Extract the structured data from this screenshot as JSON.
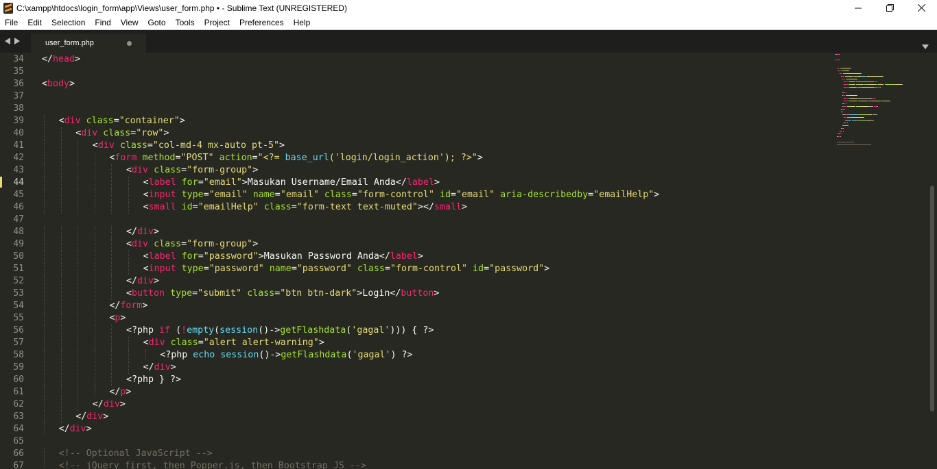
{
  "window": {
    "title": "C:\\xampp\\htdocs\\login_form\\app\\Views\\user_form.php • - Sublime Text (UNREGISTERED)"
  },
  "menu": [
    "File",
    "Edit",
    "Selection",
    "Find",
    "View",
    "Goto",
    "Tools",
    "Project",
    "Preferences",
    "Help"
  ],
  "tab": {
    "label": "user_form.php"
  },
  "editor": {
    "current_line": 44,
    "lines": [
      {
        "n": "34",
        "indent": 0,
        "tokens": [
          [
            "p",
            "</"
          ],
          [
            "t",
            "head"
          ],
          [
            "p",
            ">"
          ]
        ]
      },
      {
        "n": "35",
        "indent": 0,
        "tokens": []
      },
      {
        "n": "36",
        "indent": 0,
        "tokens": [
          [
            "p",
            "<"
          ],
          [
            "t",
            "body"
          ],
          [
            "p",
            ">"
          ]
        ]
      },
      {
        "n": "37",
        "indent": 0,
        "tokens": []
      },
      {
        "n": "38",
        "indent": 0,
        "tokens": []
      },
      {
        "n": "39",
        "indent": 1,
        "tokens": [
          [
            "p",
            "<"
          ],
          [
            "t",
            "div"
          ],
          [
            "p",
            " "
          ],
          [
            "a",
            "class"
          ],
          [
            "p",
            "="
          ],
          [
            "s",
            "\"container\""
          ],
          [
            "p",
            ">"
          ]
        ]
      },
      {
        "n": "40",
        "indent": 2,
        "tokens": [
          [
            "p",
            "<"
          ],
          [
            "t",
            "div"
          ],
          [
            "p",
            " "
          ],
          [
            "a",
            "class"
          ],
          [
            "p",
            "="
          ],
          [
            "s",
            "\"row\""
          ],
          [
            "p",
            ">"
          ]
        ]
      },
      {
        "n": "41",
        "indent": 3,
        "tokens": [
          [
            "p",
            "<"
          ],
          [
            "t",
            "div"
          ],
          [
            "p",
            " "
          ],
          [
            "a",
            "class"
          ],
          [
            "p",
            "="
          ],
          [
            "s",
            "\"col-md-4 mx-auto pt-5\""
          ],
          [
            "p",
            ">"
          ]
        ]
      },
      {
        "n": "42",
        "indent": 4,
        "tokens": [
          [
            "p",
            "<"
          ],
          [
            "t",
            "form"
          ],
          [
            "p",
            " "
          ],
          [
            "a",
            "method"
          ],
          [
            "p",
            "="
          ],
          [
            "s",
            "\"POST\""
          ],
          [
            "p",
            " "
          ],
          [
            "a",
            "action"
          ],
          [
            "p",
            "="
          ],
          [
            "s",
            "\"<?= "
          ],
          [
            "f",
            "base_url"
          ],
          [
            "s",
            "('login/login_action'); ?>\""
          ],
          [
            "p",
            ">"
          ]
        ]
      },
      {
        "n": "43",
        "indent": 5,
        "tokens": [
          [
            "p",
            "<"
          ],
          [
            "t",
            "div"
          ],
          [
            "p",
            " "
          ],
          [
            "a",
            "class"
          ],
          [
            "p",
            "="
          ],
          [
            "s",
            "\"form-group\""
          ],
          [
            "p",
            ">"
          ]
        ]
      },
      {
        "n": "44",
        "indent": 6,
        "tokens": [
          [
            "p",
            "<"
          ],
          [
            "t",
            "label"
          ],
          [
            "p",
            " "
          ],
          [
            "a",
            "for"
          ],
          [
            "p",
            "="
          ],
          [
            "s",
            "\"email\""
          ],
          [
            "p",
            ">Masukan Username/Email Anda</"
          ],
          [
            "t",
            "label"
          ],
          [
            "p",
            ">"
          ]
        ]
      },
      {
        "n": "45",
        "indent": 6,
        "tokens": [
          [
            "p",
            "<"
          ],
          [
            "t",
            "input"
          ],
          [
            "p",
            " "
          ],
          [
            "a",
            "type"
          ],
          [
            "p",
            "="
          ],
          [
            "s",
            "\"email\""
          ],
          [
            "p",
            " "
          ],
          [
            "a",
            "name"
          ],
          [
            "p",
            "="
          ],
          [
            "s",
            "\"email\""
          ],
          [
            "p",
            " "
          ],
          [
            "a",
            "class"
          ],
          [
            "p",
            "="
          ],
          [
            "s",
            "\"form-control\""
          ],
          [
            "p",
            " "
          ],
          [
            "a",
            "id"
          ],
          [
            "p",
            "="
          ],
          [
            "s",
            "\"email\""
          ],
          [
            "p",
            " "
          ],
          [
            "a",
            "aria-describedby"
          ],
          [
            "p",
            "="
          ],
          [
            "s",
            "\"emailHelp\""
          ],
          [
            "p",
            ">"
          ]
        ]
      },
      {
        "n": "46",
        "indent": 6,
        "tokens": [
          [
            "p",
            "<"
          ],
          [
            "t",
            "small"
          ],
          [
            "p",
            " "
          ],
          [
            "a",
            "id"
          ],
          [
            "p",
            "="
          ],
          [
            "s",
            "\"emailHelp\""
          ],
          [
            "p",
            " "
          ],
          [
            "a",
            "class"
          ],
          [
            "p",
            "="
          ],
          [
            "s",
            "\"form-text text-muted\""
          ],
          [
            "p",
            "></"
          ],
          [
            "t",
            "small"
          ],
          [
            "p",
            ">"
          ]
        ]
      },
      {
        "n": "47",
        "indent": 0,
        "tokens": []
      },
      {
        "n": "48",
        "indent": 5,
        "tokens": [
          [
            "p",
            "</"
          ],
          [
            "t",
            "div"
          ],
          [
            "p",
            ">"
          ]
        ]
      },
      {
        "n": "49",
        "indent": 5,
        "tokens": [
          [
            "p",
            "<"
          ],
          [
            "t",
            "div"
          ],
          [
            "p",
            " "
          ],
          [
            "a",
            "class"
          ],
          [
            "p",
            "="
          ],
          [
            "s",
            "\"form-group\""
          ],
          [
            "p",
            ">"
          ]
        ]
      },
      {
        "n": "50",
        "indent": 6,
        "tokens": [
          [
            "p",
            "<"
          ],
          [
            "t",
            "label"
          ],
          [
            "p",
            " "
          ],
          [
            "a",
            "for"
          ],
          [
            "p",
            "="
          ],
          [
            "s",
            "\"password\""
          ],
          [
            "p",
            ">Masukan Password Anda</"
          ],
          [
            "t",
            "label"
          ],
          [
            "p",
            ">"
          ]
        ]
      },
      {
        "n": "51",
        "indent": 6,
        "tokens": [
          [
            "p",
            "<"
          ],
          [
            "t",
            "input"
          ],
          [
            "p",
            " "
          ],
          [
            "a",
            "type"
          ],
          [
            "p",
            "="
          ],
          [
            "s",
            "\"password\""
          ],
          [
            "p",
            " "
          ],
          [
            "a",
            "name"
          ],
          [
            "p",
            "="
          ],
          [
            "s",
            "\"password\""
          ],
          [
            "p",
            " "
          ],
          [
            "a",
            "class"
          ],
          [
            "p",
            "="
          ],
          [
            "s",
            "\"form-control\""
          ],
          [
            "p",
            " "
          ],
          [
            "a",
            "id"
          ],
          [
            "p",
            "="
          ],
          [
            "s",
            "\"password\""
          ],
          [
            "p",
            ">"
          ]
        ]
      },
      {
        "n": "52",
        "indent": 5,
        "tokens": [
          [
            "p",
            "</"
          ],
          [
            "t",
            "div"
          ],
          [
            "p",
            ">"
          ]
        ]
      },
      {
        "n": "53",
        "indent": 5,
        "tokens": [
          [
            "p",
            "<"
          ],
          [
            "t",
            "button"
          ],
          [
            "p",
            " "
          ],
          [
            "a",
            "type"
          ],
          [
            "p",
            "="
          ],
          [
            "s",
            "\"submit\""
          ],
          [
            "p",
            " "
          ],
          [
            "a",
            "class"
          ],
          [
            "p",
            "="
          ],
          [
            "s",
            "\"btn btn-dark\""
          ],
          [
            "p",
            ">Login</"
          ],
          [
            "t",
            "button"
          ],
          [
            "p",
            ">"
          ]
        ]
      },
      {
        "n": "54",
        "indent": 4,
        "tokens": [
          [
            "p",
            "</"
          ],
          [
            "t",
            "form"
          ],
          [
            "p",
            ">"
          ]
        ]
      },
      {
        "n": "55",
        "indent": 4,
        "tokens": [
          [
            "p",
            "<"
          ],
          [
            "t",
            "p"
          ],
          [
            "p",
            ">"
          ]
        ]
      },
      {
        "n": "56",
        "indent": 5,
        "tokens": [
          [
            "p",
            "<?php "
          ],
          [
            "k",
            "if"
          ],
          [
            "p",
            " ("
          ],
          [
            "k",
            "!"
          ],
          [
            "f",
            "empty"
          ],
          [
            "p",
            "("
          ],
          [
            "f",
            "session"
          ],
          [
            "p",
            "()->"
          ],
          [
            "a",
            "getFlashdata"
          ],
          [
            "p",
            "("
          ],
          [
            "s",
            "'gagal'"
          ],
          [
            "p",
            ")))"
          ],
          [
            "p",
            " { ?>"
          ]
        ]
      },
      {
        "n": "57",
        "indent": 6,
        "tokens": [
          [
            "p",
            "<"
          ],
          [
            "t",
            "div"
          ],
          [
            "p",
            " "
          ],
          [
            "a",
            "class"
          ],
          [
            "p",
            "="
          ],
          [
            "s",
            "\"alert alert-warning\""
          ],
          [
            "p",
            ">"
          ]
        ]
      },
      {
        "n": "58",
        "indent": 7,
        "tokens": [
          [
            "p",
            "<?php "
          ],
          [
            "f",
            "echo"
          ],
          [
            "p",
            " "
          ],
          [
            "f",
            "session"
          ],
          [
            "p",
            "()->"
          ],
          [
            "a",
            "getFlashdata"
          ],
          [
            "p",
            "("
          ],
          [
            "s",
            "'gagal'"
          ],
          [
            "p",
            ") ?>"
          ]
        ]
      },
      {
        "n": "59",
        "indent": 6,
        "tokens": [
          [
            "p",
            "</"
          ],
          [
            "t",
            "div"
          ],
          [
            "p",
            ">"
          ]
        ]
      },
      {
        "n": "60",
        "indent": 5,
        "tokens": [
          [
            "p",
            "<?php } ?>"
          ]
        ]
      },
      {
        "n": "61",
        "indent": 4,
        "tokens": [
          [
            "p",
            "</"
          ],
          [
            "t",
            "p"
          ],
          [
            "p",
            ">"
          ]
        ]
      },
      {
        "n": "62",
        "indent": 3,
        "tokens": [
          [
            "p",
            "</"
          ],
          [
            "t",
            "div"
          ],
          [
            "p",
            ">"
          ]
        ]
      },
      {
        "n": "63",
        "indent": 2,
        "tokens": [
          [
            "p",
            "</"
          ],
          [
            "t",
            "div"
          ],
          [
            "p",
            ">"
          ]
        ]
      },
      {
        "n": "64",
        "indent": 1,
        "tokens": [
          [
            "p",
            "</"
          ],
          [
            "t",
            "div"
          ],
          [
            "p",
            ">"
          ]
        ]
      },
      {
        "n": "65",
        "indent": 0,
        "tokens": []
      },
      {
        "n": "66",
        "indent": 1,
        "tokens": [
          [
            "c",
            "<!-- Optional JavaScript -->"
          ]
        ]
      },
      {
        "n": "67",
        "indent": 1,
        "tokens": [
          [
            "c",
            "<!-- jQuery first, then Popper.js, then Bootstrap JS -->"
          ]
        ]
      }
    ]
  },
  "colors": {
    "background": "#272822",
    "tag": "#f92672",
    "attribute": "#a6e22e",
    "string": "#e6db74",
    "function": "#66d9ef",
    "comment": "#75715e",
    "text": "#f8f8f2"
  }
}
